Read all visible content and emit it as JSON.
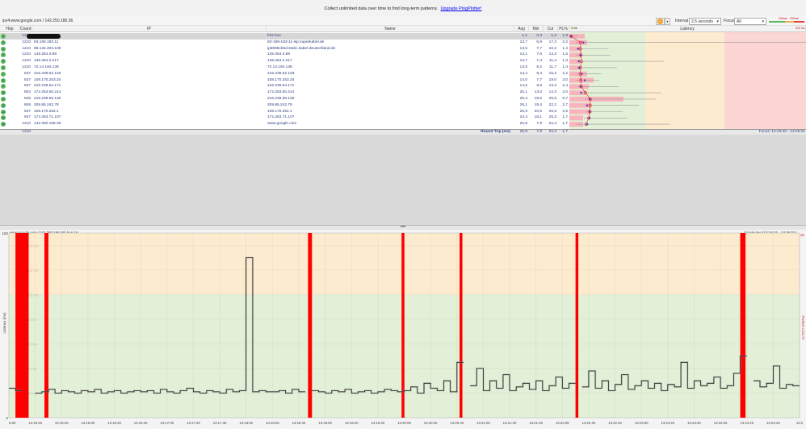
{
  "promo": {
    "text": "Collect unlimited data over time to find long-term patterns.",
    "link": "Upgrade PingPlotter!"
  },
  "breadcrumb": "ipv4:www.google.com / 142.250.186.36",
  "controls": {
    "pause_icon": "pause-icon",
    "interval_label": "Interval",
    "interval_value": "2.5 seconds",
    "focus_label": "Focus",
    "focus_value": "All",
    "legend_100": "100ms",
    "legend_200": "200ms"
  },
  "colors": {
    "green": "#e1f0d6",
    "orange": "#fdebd0",
    "red": "#fcd5d5",
    "loss": "#ff0000",
    "hop_ok": "#5cb85c"
  },
  "table": {
    "headers": {
      "hop": "Hop",
      "count": "Count",
      "ip": "IP",
      "name": "Name",
      "avg": "Avg",
      "min": "Min",
      "cur": "Cur",
      "pl": "PL%",
      "latency": "Latency",
      "scale_min": "0 ms",
      "scale_max": "310 ms"
    },
    "scale_max_ms": 310,
    "rows": [
      {
        "hop": "1",
        "count": "1210",
        "ip": "",
        "name": "fritz.box",
        "avg": "1,1",
        "min": "0,4",
        "cur": "1,2",
        "pl": "1,9",
        "max_ms": 11
      },
      {
        "hop": "2",
        "count": "1210",
        "ip": "83.169.183.11",
        "name": "83-169-183-11-isp.superkabel.de",
        "avg": "13,7",
        "min": "6,9",
        "cur": "17,3",
        "pl": "2,2",
        "max_ms": 310
      },
      {
        "hop": "3",
        "count": "1210",
        "ip": "88.134.203.109",
        "name": "ip5886cb6d.static.kabel-deutschland.de",
        "avg": "13,5",
        "min": "7,7",
        "cur": "10,3",
        "pl": "1,4",
        "max_ms": 51
      },
      {
        "hop": "4",
        "count": "1210",
        "ip": "145.254.3.88",
        "name": "145.254.3.88",
        "avg": "14,1",
        "min": "7,6",
        "cur": "13,3",
        "pl": "1,5",
        "max_ms": 53
      },
      {
        "hop": "5",
        "count": "1210",
        "ip": "145.254.2.217",
        "name": "145.254.2.217",
        "avg": "14,7",
        "min": "7,4",
        "cur": "11,4",
        "pl": "1,3",
        "max_ms": 124
      },
      {
        "hop": "6",
        "count": "1210",
        "ip": "72.14.194.138",
        "name": "72.14.194.138",
        "avg": "13,5",
        "min": "8,2",
        "cur": "11,7",
        "pl": "1,4",
        "max_ms": 62
      },
      {
        "hop": "7",
        "count": "637",
        "ip": "216.239.62.103",
        "name": "216.239.62.103",
        "avg": "13,4",
        "min": "9,4",
        "cur": "15,3",
        "pl": "2,2",
        "max_ms": 42
      },
      {
        "hop": "8",
        "count": "637",
        "ip": "108.170.253.34",
        "name": "108.170.253.34",
        "avg": "14,0",
        "min": "7,7",
        "cur": "19,0",
        "pl": "3,0",
        "max_ms": 39
      },
      {
        "hop": "9",
        "count": "637",
        "ip": "216.239.54.171",
        "name": "216.239.54.171",
        "avg": "14,5",
        "min": "9,8",
        "cur": "13,3",
        "pl": "2,4",
        "max_ms": 65
      },
      {
        "hop": "10",
        "count": "803",
        "ip": "172.253.50.214",
        "name": "172.253.50.214",
        "avg": "20,1",
        "min": "13,0",
        "cur": "14,3",
        "pl": "2,0",
        "max_ms": 120
      },
      {
        "hop": "11",
        "count": "848",
        "ip": "216.239.56.130",
        "name": "216.239.56.130",
        "avg": "26,4",
        "min": "19,0",
        "cur": "25,5",
        "pl": "6,7",
        "max_ms": 113
      },
      {
        "hop": "12",
        "count": "808",
        "ip": "209.85.242.78",
        "name": "209.85.242.78",
        "avg": "26,1",
        "min": "19,4",
        "cur": "22,2",
        "pl": "2,7",
        "max_ms": 91
      },
      {
        "hop": "13",
        "count": "637",
        "ip": "108.170.252.1",
        "name": "108.170.252.1",
        "avg": "25,9",
        "min": "20,5",
        "cur": "25,5",
        "pl": "2,5",
        "max_ms": 70
      },
      {
        "hop": "14",
        "count": "637",
        "ip": "172.253.71.107",
        "name": "172.253.71.107",
        "avg": "24,4",
        "min": "18,1",
        "cur": "25,3",
        "pl": "1,7",
        "max_ms": 76
      },
      {
        "hop": "15",
        "count": "1210",
        "ip": "142.250.186.36",
        "name": "www.google.com",
        "avg": "20,8",
        "min": "7,9",
        "cur": "22,4",
        "pl": "1,7",
        "max_ms": 132
      }
    ],
    "summary": {
      "count": "1210",
      "label": "Round Trip (ms)",
      "avg": "20,8",
      "min": "7,9",
      "cur": "22,4",
      "pl": "1,7",
      "focus": "Focus: 12:33:40 - 13:25:01"
    }
  },
  "splitter": "•••",
  "chart_data": {
    "type": "line",
    "title": "www.google.com (142.250.186.36) hop 15",
    "range_label": "10 minutes (13:15:01 - 13:25:01)",
    "ylabel": "Latency (ms)",
    "y2label": "Packet Loss %",
    "y2max": "30",
    "ylim": [
      0,
      150
    ],
    "yticks": [
      "150",
      "140 ms",
      "120 ms",
      "100 ms",
      "80 ms",
      "60 ms",
      "40 ms",
      "20 ms",
      "0"
    ],
    "xtick_seconds": 20,
    "xticks": [
      "5:00",
      "13:15:20",
      "13:15:40",
      "13:16:00",
      "13:16:20",
      "13:16:40",
      "13:17:00",
      "13:17:20",
      "13:17:40",
      "13:18:00",
      "13:18:20",
      "13:18:40",
      "13:19:00",
      "13:19:20",
      "13:19:40",
      "13:20:00",
      "13:20:20",
      "13:20:40",
      "13:21:00",
      "13:21:20",
      "13:21:40",
      "13:22:00",
      "13:22:20",
      "13:22:40",
      "13:23:00",
      "13:23:20",
      "13:23:40",
      "13:24:00",
      "13:24:20",
      "13:24:40",
      "13:2"
    ],
    "x_seconds_total": 600,
    "sample_step_s": 5,
    "latency_ms": [
      24,
      22,
      null,
      null,
      20,
      21,
      23,
      20,
      22,
      21,
      20,
      22,
      21,
      23,
      20,
      21,
      22,
      20,
      21,
      22,
      21,
      22,
      20,
      23,
      21,
      20,
      22,
      24,
      21,
      20,
      22,
      21,
      20,
      23,
      21,
      22,
      130,
      21,
      22,
      21,
      21,
      22,
      20,
      23,
      21,
      null,
      22,
      21,
      20,
      22,
      21,
      23,
      20,
      21,
      22,
      20,
      21,
      23,
      22,
      21,
      22,
      25,
      20,
      28,
      24,
      22,
      30,
      21,
      45,
      null,
      26,
      40,
      22,
      30,
      24,
      35,
      22,
      25,
      28,
      23,
      30,
      22,
      26,
      33,
      24,
      28,
      null,
      25,
      38,
      24,
      30,
      22,
      27,
      35,
      23,
      26,
      30,
      24,
      28,
      22,
      27,
      25,
      45,
      24,
      30,
      26,
      28,
      33,
      24,
      26,
      36,
      50,
      null,
      30,
      25,
      28,
      42,
      24,
      27,
      26
    ],
    "loss_events_s": [
      [
        5,
        15
      ],
      [
        27,
        30
      ],
      [
        227,
        230
      ],
      [
        298,
        300
      ],
      [
        342,
        344
      ],
      [
        430,
        432
      ],
      [
        555,
        559
      ]
    ],
    "zones": [
      {
        "from": 0,
        "to": 100,
        "color": "#e1f0d6"
      },
      {
        "from": 100,
        "to": 150,
        "color": "#fdebd0"
      }
    ]
  }
}
